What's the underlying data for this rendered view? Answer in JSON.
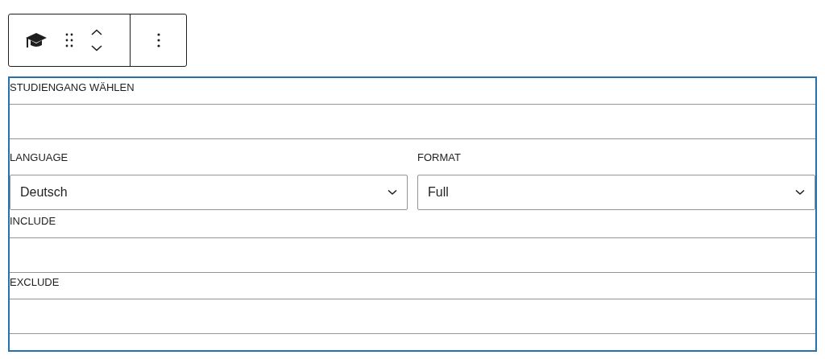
{
  "fields": [
    {
      "kind": "text",
      "label": "STUDIENGANG WÄHLEN"
    },
    {
      "kind": "selects",
      "items": [
        {
          "label": "LANGUAGE",
          "value": "Deutsch"
        },
        {
          "label": "FORMAT",
          "value": "Full"
        }
      ]
    },
    {
      "kind": "text",
      "label": "INCLUDE"
    },
    {
      "kind": "text",
      "label": "EXCLUDE"
    }
  ]
}
